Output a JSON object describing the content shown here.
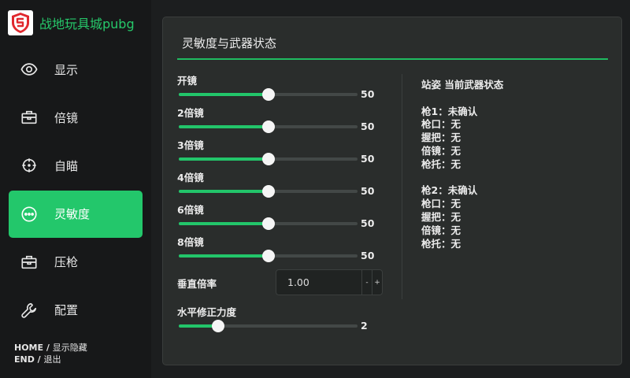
{
  "app": {
    "title": "战地玩具城pubg",
    "brand_color": "#23c76b"
  },
  "sidebar": {
    "items": [
      {
        "label": "显示",
        "icon": "eye-icon",
        "active": false
      },
      {
        "label": "倍镜",
        "icon": "briefcase-icon",
        "active": false
      },
      {
        "label": "自瞄",
        "icon": "crosshair-icon",
        "active": false
      },
      {
        "label": "灵敏度",
        "icon": "more-circle-icon",
        "active": true
      },
      {
        "label": "压枪",
        "icon": "toolbox-icon",
        "active": false
      },
      {
        "label": "配置",
        "icon": "wrench-icon",
        "active": false
      }
    ],
    "hints": [
      {
        "key": "HOME / ",
        "desc": "显示隐藏"
      },
      {
        "key": "END / ",
        "desc": "退出"
      }
    ]
  },
  "panel": {
    "title": "灵敏度与武器状态",
    "sliders": [
      {
        "label": "开镜",
        "value": "50",
        "fraction": 0.5
      },
      {
        "label": "2倍镜",
        "value": "50",
        "fraction": 0.5
      },
      {
        "label": "3倍镜",
        "value": "50",
        "fraction": 0.5
      },
      {
        "label": "4倍镜",
        "value": "50",
        "fraction": 0.5
      },
      {
        "label": "6倍镜",
        "value": "50",
        "fraction": 0.5
      },
      {
        "label": "8倍镜",
        "value": "50",
        "fraction": 0.5
      }
    ],
    "vertical": {
      "label": "垂直倍率",
      "value": "1.00",
      "dec_label": "-",
      "inc_label": "+"
    },
    "horizontal": {
      "label": "水平修正力度",
      "value": "2",
      "fraction": 0.22
    },
    "status": {
      "header": "站姿 当前武器状态",
      "gun1": [
        "枪1：未确认",
        "枪口：无",
        "握把：无",
        "倍镜：无",
        "枪托：无"
      ],
      "gun2": [
        "枪2：未确认",
        "枪口：无",
        "握把：无",
        "倍镜：无",
        "枪托：无"
      ]
    }
  }
}
